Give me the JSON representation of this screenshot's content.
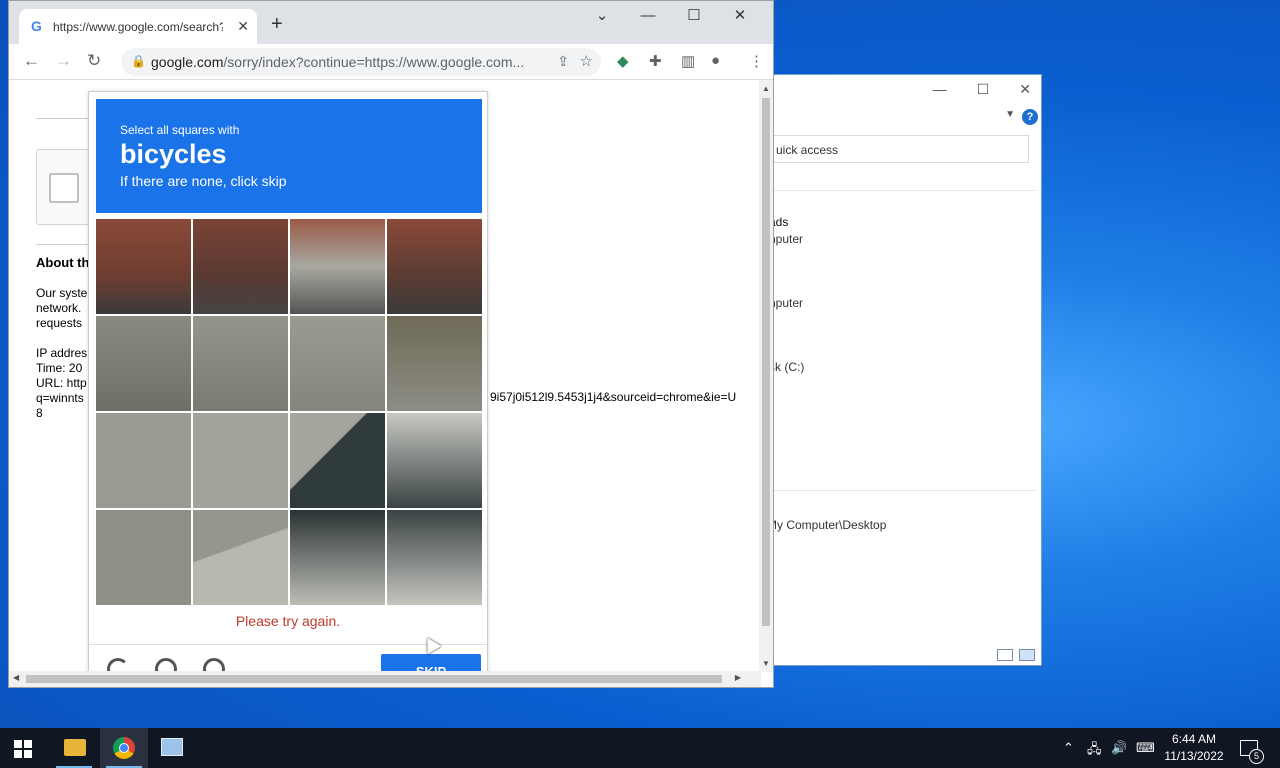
{
  "explorer": {
    "minimize": "—",
    "maximize": "☐",
    "close": "✕",
    "help": "?",
    "address": "uick access",
    "items": [
      "ads",
      "nputer",
      "nputer",
      "sk (C:)"
    ],
    "status_path": "My Computer\\Desktop"
  },
  "chrome": {
    "tab_title": "https://www.google.com/search?",
    "tab_close": "✕",
    "new_tab": "+",
    "win_controls": {
      "dropdown": "⌄",
      "minimize": "—",
      "maximize": "☐",
      "close": "✕"
    },
    "url_host": "google.com",
    "url_rest": "/sorry/index?continue=https://www.google.com...",
    "nav": {
      "back": "←",
      "forward": "→",
      "reload": "↻"
    }
  },
  "page": {
    "about_heading": "About th",
    "paragraph": [
      "Our syste",
      "network.",
      "requests"
    ],
    "details": [
      "IP addres",
      "Time: 20",
      "URL: http",
      "q=winnts",
      "8"
    ],
    "url_tail": "9i57j0i512l9.5453j1j4&sourceid=chrome&ie=U"
  },
  "captcha": {
    "instruction": "Select all squares with",
    "target": "bicycles",
    "hint": "If there are none, click skip",
    "error": "Please try again.",
    "skip_label": "SKIP"
  },
  "taskbar": {
    "time": "6:44 AM",
    "date": "11/13/2022",
    "notification_count": "5"
  },
  "colors": {
    "captcha_blue": "#1a73e8",
    "error_red": "#c0392b",
    "taskbar": "#101622"
  }
}
